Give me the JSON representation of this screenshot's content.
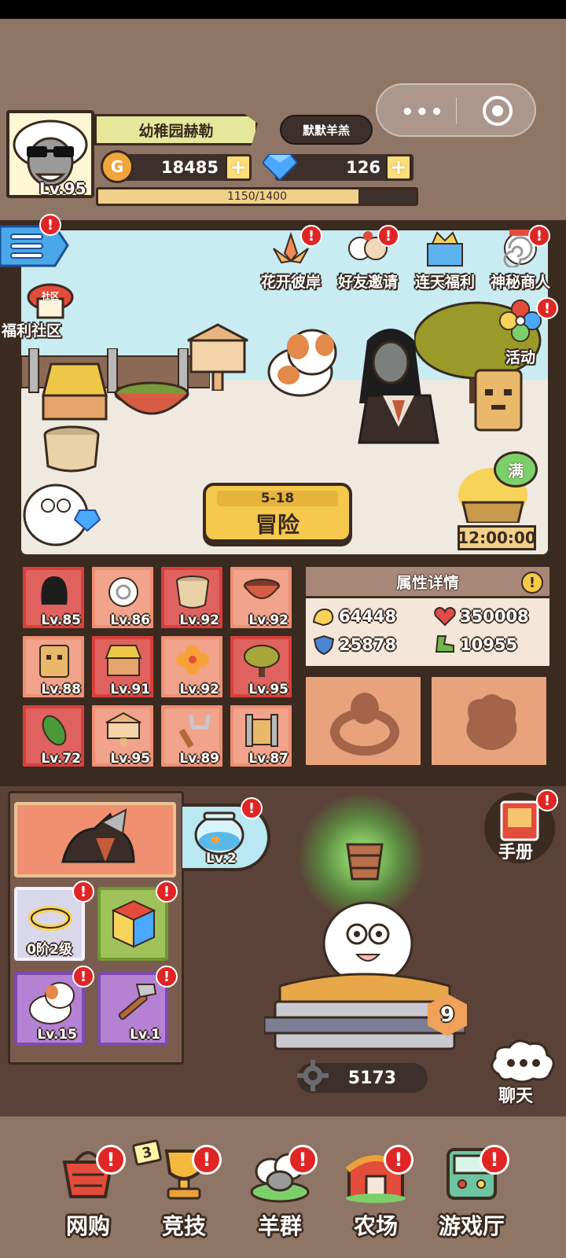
{
  "player": {
    "level": "Lv.95",
    "name": "幼稚园赫勒",
    "guild": "默默羊羔",
    "gold": "18485",
    "gems": "126",
    "xp_text": "1150/1400",
    "xp_fraction": 0.82
  },
  "miniprogram": {
    "more_icon": "more-dots-icon",
    "close_icon": "target-icon"
  },
  "events": [
    {
      "label": "花开彼岸",
      "badge": "!"
    },
    {
      "label": "好友邀请",
      "badge": "!"
    },
    {
      "label": "连天福利",
      "badge": "!"
    },
    {
      "label": "神秘商人",
      "badge": "!"
    }
  ],
  "activity": {
    "label": "活动",
    "badge": "!"
  },
  "community": {
    "label": "福利社区",
    "sign": "社区"
  },
  "menu_badge": "!",
  "adventure": {
    "stage": "5-18",
    "label": "冒险"
  },
  "timer": "12:00:00",
  "full_bubble": "满",
  "items": [
    {
      "level": "Lv.85",
      "icon": "hair-icon",
      "bg": "red"
    },
    {
      "level": "Lv.86",
      "icon": "shell-icon",
      "bg": "salmon"
    },
    {
      "level": "Lv.92",
      "icon": "pot-icon",
      "bg": "red"
    },
    {
      "level": "Lv.92",
      "icon": "bowl-icon",
      "bg": "salmon"
    },
    {
      "level": "Lv.88",
      "icon": "totem-icon",
      "bg": "salmon"
    },
    {
      "level": "Lv.91",
      "icon": "well-icon",
      "bg": "red"
    },
    {
      "level": "Lv.92",
      "icon": "flower-icon",
      "bg": "salmon"
    },
    {
      "level": "Lv.95",
      "icon": "tree-icon",
      "bg": "red"
    },
    {
      "level": "Lv.72",
      "icon": "pickle-icon",
      "bg": "red"
    },
    {
      "level": "Lv.95",
      "icon": "signboard-icon",
      "bg": "salmon"
    },
    {
      "level": "Lv.89",
      "icon": "fork-icon",
      "bg": "salmon"
    },
    {
      "level": "Lv.87",
      "icon": "gate-icon",
      "bg": "salmon"
    }
  ],
  "attributes": {
    "title": "属性详情",
    "info": "!",
    "attack": "64448",
    "hp": "350008",
    "defense": "25878",
    "speed": "10955"
  },
  "skills": [
    {
      "label": "0阶2级",
      "icon": "halo-icon",
      "badge": "!"
    },
    {
      "label": "",
      "icon": "cube-icon",
      "badge": "!"
    },
    {
      "label": "Lv.15",
      "icon": "dog-icon",
      "badge": "!"
    },
    {
      "label": "Lv.1",
      "icon": "hammer-icon",
      "badge": "!"
    }
  ],
  "fishbowl": {
    "level": "Lv.2",
    "badge": "!"
  },
  "handbook": {
    "label": "手册",
    "badge": "!"
  },
  "chat": {
    "label": "聊天"
  },
  "pen": {
    "wool": "5173",
    "level": "9"
  },
  "nav": [
    {
      "label": "网购",
      "icon": "basket-icon",
      "badge": "!"
    },
    {
      "label": "竞技",
      "icon": "trophy-icon",
      "badge": "!",
      "count": "3"
    },
    {
      "label": "羊群",
      "icon": "flock-icon",
      "badge": "!"
    },
    {
      "label": "农场",
      "icon": "barn-icon",
      "badge": "!"
    },
    {
      "label": "游戏厅",
      "icon": "arcade-icon",
      "badge": "!"
    }
  ],
  "colors": {
    "gold": "#f5c94e",
    "badge_red": "#e02525",
    "frame": "#3a2a20"
  }
}
